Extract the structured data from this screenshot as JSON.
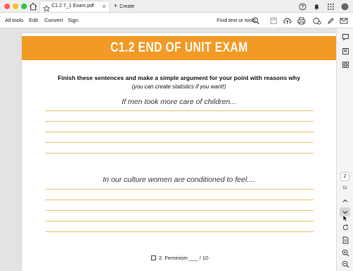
{
  "window": {
    "tab_title": "C1.2 7_1 Exam.pdf",
    "tab_close": "×",
    "new_tab_plus": "+",
    "new_tab_label": "Create"
  },
  "menubar": {
    "items": [
      "All tools",
      "Edit",
      "Convert",
      "Sign"
    ],
    "find_label": "Find text or tools"
  },
  "document": {
    "banner_title": "C1.2 END OF UNIT EXAM",
    "instruction": "Finish these sentences and make a simple argument for your point with reasons why",
    "instruction_note": "(you can create statistics if you want!)",
    "prompts": [
      "If men took more care of children...",
      "In our culture women are conditioned to feel...."
    ],
    "footer_label": "2. Feminism ___ / 10"
  },
  "sidebar": {
    "current_page": "2",
    "total_pages": "11"
  },
  "colors": {
    "banner": "#f29a24",
    "writing_line": "#e6c36a"
  },
  "icons": [
    "home-icon",
    "star-icon",
    "help-icon",
    "bell-icon",
    "apps-grid-icon",
    "save-icon",
    "upload-icon",
    "print-icon",
    "share-icon",
    "edit-pen-icon",
    "mail-icon",
    "comment-icon",
    "bookmark-icon",
    "thumbnails-icon",
    "chevron-up-icon",
    "chevron-down-icon",
    "refresh-icon",
    "page-settings-icon",
    "zoom-in-icon",
    "zoom-out-icon",
    "search-icon"
  ]
}
